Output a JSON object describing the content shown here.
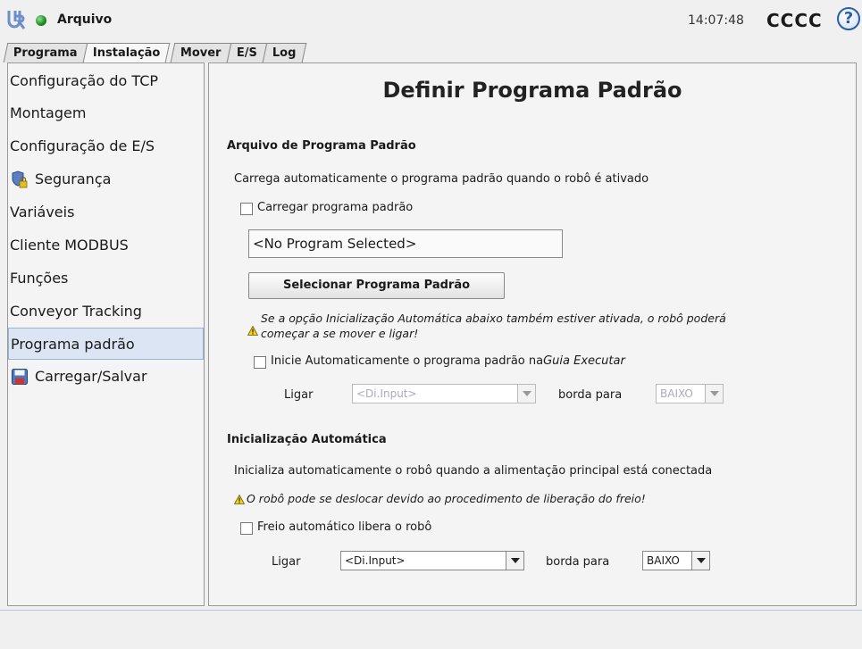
{
  "app": {
    "title": "Arquivo",
    "clock": "14:07:48",
    "robot_name": "CCCC",
    "help": "?"
  },
  "tabs": [
    {
      "label": "Programa"
    },
    {
      "label": "Instalação"
    },
    {
      "label": "Mover"
    },
    {
      "label": "E/S"
    },
    {
      "label": "Log"
    }
  ],
  "sidebar": {
    "items": [
      {
        "label": "Configuração do TCP"
      },
      {
        "label": "Montagem"
      },
      {
        "label": "Configuração de E/S"
      },
      {
        "label": "Segurança"
      },
      {
        "label": "Variáveis"
      },
      {
        "label": "Cliente MODBUS"
      },
      {
        "label": "Funções"
      },
      {
        "label": "Conveyor Tracking"
      },
      {
        "label": "Programa padrão"
      },
      {
        "label": "Carregar/Salvar"
      }
    ]
  },
  "main": {
    "title": "Definir Programa Padrão",
    "default_program": {
      "section_title": "Arquivo de Programa Padrão",
      "description": "Carrega automaticamente o programa padrão quando o robô é ativado",
      "load_checkbox_label": "Carregar programa padrão",
      "program_field": "<No Program Selected>",
      "select_button": "Selecionar Programa Padrão",
      "warning_line1": "Se a opção Inicialização Automática abaixo também estiver ativada, o robô poderá",
      "warning_line2": "começar a se mover e ligar!",
      "autostart_label": "Inicie Automaticamente o programa padrão na",
      "autostart_label_italic": "Guia Executar",
      "on_label": "Ligar",
      "input_select": "<Di.Input>",
      "edge_label": "borda para",
      "edge_select": "BAIXO"
    },
    "auto_init": {
      "section_title": "Inicialização Automática",
      "description": "Inicializa automaticamente o robô quando a alimentação principal está conectada",
      "warning": "O robô pode se deslocar devido ao procedimento de liberação do freio!",
      "brake_checkbox_label": "Freio automático libera o robô",
      "on_label": "Ligar",
      "input_select": "<Di.Input>",
      "edge_label": "borda para",
      "edge_select": "BAIXO"
    }
  }
}
